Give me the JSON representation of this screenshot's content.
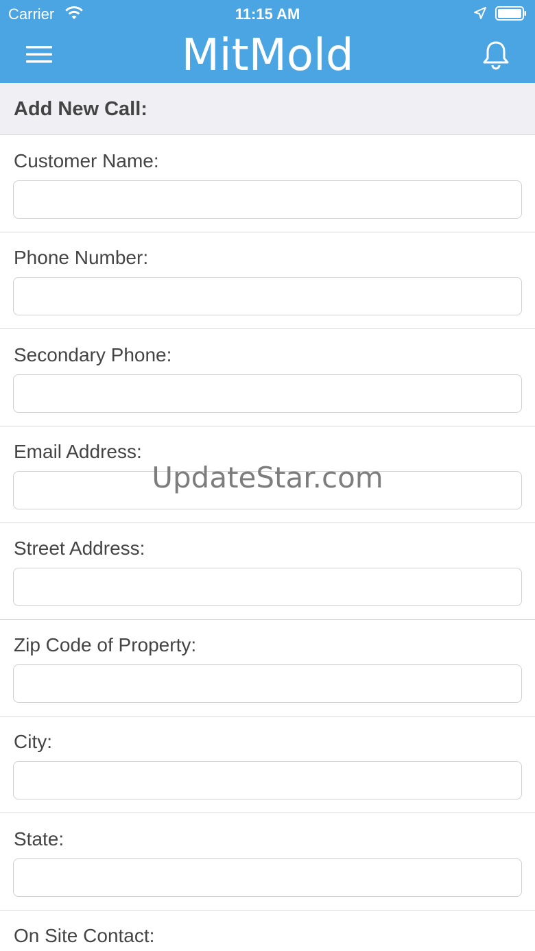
{
  "status_bar": {
    "carrier": "Carrier",
    "time": "11:15 AM",
    "wifi_icon": "wifi-icon",
    "location_icon": "location-arrow-icon",
    "battery_icon": "battery-icon"
  },
  "nav": {
    "title": "MitMold",
    "menu_icon": "hamburger-menu-icon",
    "notification_icon": "bell-icon",
    "bar_color": "#4aa5e2"
  },
  "form": {
    "heading": "Add New Call:",
    "fields": [
      {
        "label": "Customer Name:",
        "value": "",
        "placeholder": ""
      },
      {
        "label": "Phone Number:",
        "value": "",
        "placeholder": ""
      },
      {
        "label": "Secondary Phone:",
        "value": "",
        "placeholder": ""
      },
      {
        "label": "Email Address:",
        "value": "",
        "placeholder": ""
      },
      {
        "label": "Street Address:",
        "value": "",
        "placeholder": ""
      },
      {
        "label": "Zip Code of Property:",
        "value": "",
        "placeholder": ""
      },
      {
        "label": "City:",
        "value": "",
        "placeholder": ""
      },
      {
        "label": "State:",
        "value": "",
        "placeholder": ""
      },
      {
        "label": "On Site Contact:",
        "value": "",
        "placeholder": ""
      }
    ]
  },
  "watermark": "UpdateStar.com"
}
